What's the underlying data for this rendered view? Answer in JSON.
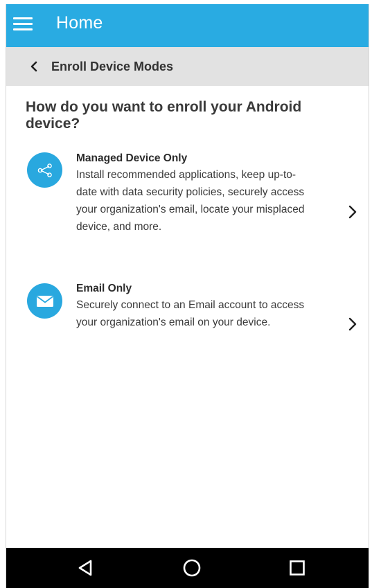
{
  "appbar": {
    "title": "Home",
    "menu_icon": "hamburger-menu-icon"
  },
  "subbar": {
    "title": "Enroll Device Modes",
    "back_icon": "chevron-left-icon"
  },
  "main": {
    "question": "How do you want to enroll your Android device?",
    "options": [
      {
        "title": "Managed Device Only",
        "description": "Install recommended applications, keep up-to-date with data security policies, securely access your organization's email, locate your misplaced device, and more.",
        "icon": "share-nodes-icon",
        "arrow_icon": "chevron-right-icon"
      },
      {
        "title": "Email Only",
        "description": "Securely connect to an Email account to access your organization's email on your device.",
        "icon": "envelope-icon",
        "arrow_icon": "chevron-right-icon"
      }
    ]
  },
  "navbar": {
    "back_icon": "nav-back-triangle-icon",
    "home_icon": "nav-home-circle-icon",
    "recents_icon": "nav-recents-square-icon"
  },
  "colors": {
    "primary": "#29abe2",
    "subbar_bg": "#e2e2e2",
    "navbar_bg": "#000000"
  }
}
